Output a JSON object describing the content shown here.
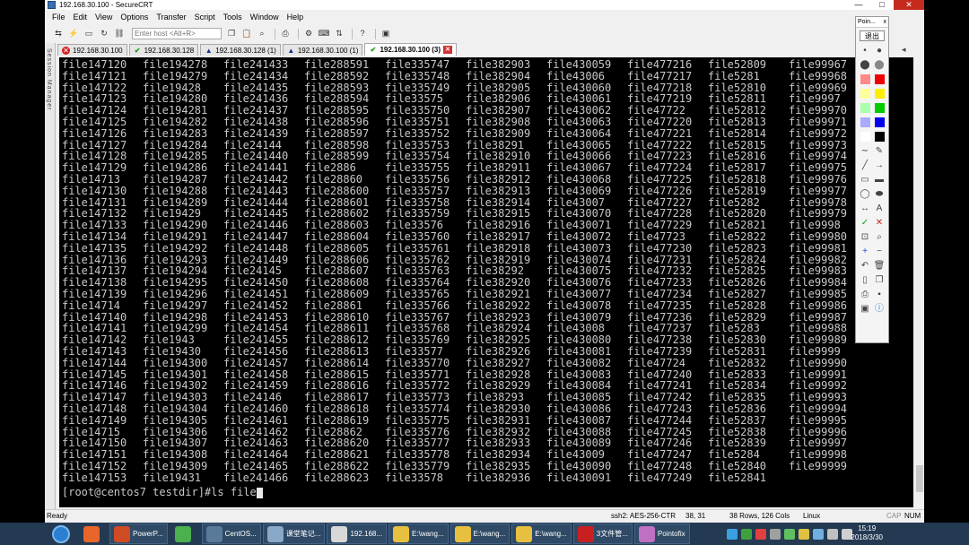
{
  "window": {
    "title": "192.168.30.100 - SecureCRT",
    "min": "—",
    "max": "□",
    "close": "✕"
  },
  "menu": [
    "File",
    "Edit",
    "View",
    "Options",
    "Transfer",
    "Script",
    "Tools",
    "Window",
    "Help"
  ],
  "toolbar": {
    "host_placeholder": "Enter host <Alt+R>"
  },
  "tabs": [
    {
      "label": "192.168.30.100",
      "status": "disconnected",
      "icon": "x-circle-icon"
    },
    {
      "label": "192.168.30.128",
      "status": "connected",
      "icon": "check-icon"
    },
    {
      "label": "192.168.30.128 (1)",
      "status": "warning",
      "icon": "warning-icon"
    },
    {
      "label": "192.168.30.100 (1)",
      "status": "warning",
      "icon": "warning-icon"
    },
    {
      "label": "192.168.30.100 (3)",
      "status": "connected",
      "icon": "check-icon",
      "active": true
    }
  ],
  "tab_nav": "◂ ▸",
  "session_manager_label": "Session Manager",
  "terminal": {
    "columns": [
      [
        "file147120",
        "file147121",
        "file147122",
        "file147123",
        "file147124",
        "file147125",
        "file147126",
        "file147127",
        "file147128",
        "file147129",
        "file14713",
        "file147130",
        "file147131",
        "file147132",
        "file147133",
        "file147134",
        "file147135",
        "file147136",
        "file147137",
        "file147138",
        "file147139",
        "file14714",
        "file147140",
        "file147141",
        "file147142",
        "file147143",
        "file147144",
        "file147145",
        "file147146",
        "file147147",
        "file147148",
        "file147149",
        "file14715",
        "file147150",
        "file147151",
        "file147152",
        "file147153"
      ],
      [
        "file194278",
        "file194279",
        "file19428",
        "file194280",
        "file194281",
        "file194282",
        "file194283",
        "file194284",
        "file194285",
        "file194286",
        "file194287",
        "file194288",
        "file194289",
        "file19429",
        "file194290",
        "file194291",
        "file194292",
        "file194293",
        "file194294",
        "file194295",
        "file194296",
        "file194297",
        "file194298",
        "file194299",
        "file1943",
        "file19430",
        "file194300",
        "file194301",
        "file194302",
        "file194303",
        "file194304",
        "file194305",
        "file194306",
        "file194307",
        "file194308",
        "file194309",
        "file19431"
      ],
      [
        "file241433",
        "file241434",
        "file241435",
        "file241436",
        "file241437",
        "file241438",
        "file241439",
        "file24144",
        "file241440",
        "file241441",
        "file241442",
        "file241443",
        "file241444",
        "file241445",
        "file241446",
        "file241447",
        "file241448",
        "file241449",
        "file24145",
        "file241450",
        "file241451",
        "file241452",
        "file241453",
        "file241454",
        "file241455",
        "file241456",
        "file241457",
        "file241458",
        "file241459",
        "file24146",
        "file241460",
        "file241461",
        "file241462",
        "file241463",
        "file241464",
        "file241465",
        "file241466"
      ],
      [
        "file288591",
        "file288592",
        "file288593",
        "file288594",
        "file288595",
        "file288596",
        "file288597",
        "file288598",
        "file288599",
        "file2886",
        "file28860",
        "file288600",
        "file288601",
        "file288602",
        "file288603",
        "file288604",
        "file288605",
        "file288606",
        "file288607",
        "file288608",
        "file288609",
        "file28861",
        "file288610",
        "file288611",
        "file288612",
        "file288613",
        "file288614",
        "file288615",
        "file288616",
        "file288617",
        "file288618",
        "file288619",
        "file28862",
        "file288620",
        "file288621",
        "file288622",
        "file288623"
      ],
      [
        "file335747",
        "file335748",
        "file335749",
        "file33575",
        "file335750",
        "file335751",
        "file335752",
        "file335753",
        "file335754",
        "file335755",
        "file335756",
        "file335757",
        "file335758",
        "file335759",
        "file33576",
        "file335760",
        "file335761",
        "file335762",
        "file335763",
        "file335764",
        "file335765",
        "file335766",
        "file335767",
        "file335768",
        "file335769",
        "file33577",
        "file335770",
        "file335771",
        "file335772",
        "file335773",
        "file335774",
        "file335775",
        "file335776",
        "file335777",
        "file335778",
        "file335779",
        "file33578"
      ],
      [
        "file382903",
        "file382904",
        "file382905",
        "file382906",
        "file382907",
        "file382908",
        "file382909",
        "file38291",
        "file382910",
        "file382911",
        "file382912",
        "file382913",
        "file382914",
        "file382915",
        "file382916",
        "file382917",
        "file382918",
        "file382919",
        "file38292",
        "file382920",
        "file382921",
        "file382922",
        "file382923",
        "file382924",
        "file382925",
        "file382926",
        "file382927",
        "file382928",
        "file382929",
        "file38293",
        "file382930",
        "file382931",
        "file382932",
        "file382933",
        "file382934",
        "file382935",
        "file382936"
      ],
      [
        "file430059",
        "file43006",
        "file430060",
        "file430061",
        "file430062",
        "file430063",
        "file430064",
        "file430065",
        "file430066",
        "file430067",
        "file430068",
        "file430069",
        "file43007",
        "file430070",
        "file430071",
        "file430072",
        "file430073",
        "file430074",
        "file430075",
        "file430076",
        "file430077",
        "file430078",
        "file430079",
        "file43008",
        "file430080",
        "file430081",
        "file430082",
        "file430083",
        "file430084",
        "file430085",
        "file430086",
        "file430087",
        "file430088",
        "file430089",
        "file43009",
        "file430090",
        "file430091"
      ],
      [
        "file477216",
        "file477217",
        "file477218",
        "file477219",
        "file47722",
        "file477220",
        "file477221",
        "file477222",
        "file477223",
        "file477224",
        "file477225",
        "file477226",
        "file477227",
        "file477228",
        "file477229",
        "file47723",
        "file477230",
        "file477231",
        "file477232",
        "file477233",
        "file477234",
        "file477235",
        "file477236",
        "file477237",
        "file477238",
        "file477239",
        "file47724",
        "file477240",
        "file477241",
        "file477242",
        "file477243",
        "file477244",
        "file477245",
        "file477246",
        "file477247",
        "file477248",
        "file477249"
      ],
      [
        "file52809",
        "file5281",
        "file52810",
        "file52811",
        "file52812",
        "file52813",
        "file52814",
        "file52815",
        "file52816",
        "file52817",
        "file52818",
        "file52819",
        "file5282",
        "file52820",
        "file52821",
        "file52822",
        "file52823",
        "file52824",
        "file52825",
        "file52826",
        "file52827",
        "file52828",
        "file52829",
        "file5283",
        "file52830",
        "file52831",
        "file52832",
        "file52833",
        "file52834",
        "file52835",
        "file52836",
        "file52837",
        "file52838",
        "file52839",
        "file5284",
        "file52840",
        "file52841"
      ],
      [
        "file99967",
        "file99968",
        "file99969",
        "file9997",
        "file99970",
        "file99971",
        "file99972",
        "file99973",
        "file99974",
        "file99975",
        "file99976",
        "file99977",
        "file99978",
        "file99979",
        "file9998",
        "file99980",
        "file99981",
        "file99982",
        "file99983",
        "file99984",
        "file99985",
        "file99986",
        "file99987",
        "file99988",
        "file99989",
        "file9999",
        "file99990",
        "file99991",
        "file99992",
        "file99993",
        "file99994",
        "file99995",
        "file99996",
        "file99997",
        "file99998",
        "file99999",
        ""
      ]
    ],
    "prompt": "[root@centos7 testdir]#ls file"
  },
  "status": {
    "ready": "Ready",
    "cipher": "ssh2: AES-256-CTR",
    "position": "38,  31",
    "size": "38 Rows, 126 Cols",
    "os": "Linux",
    "caps": "CAP",
    "num": "NUM"
  },
  "pointofix": {
    "title": "Poin...",
    "close": "x",
    "exit": "退出",
    "swatches": [
      "#ff8888",
      "#ee0000",
      "#ffff99",
      "#ffee00",
      "#aaffaa",
      "#00cc00",
      "#aaaaff",
      "#0000ee",
      "#ffffff",
      "#000000"
    ]
  },
  "taskbar": {
    "items": [
      {
        "label": "",
        "icon": "firefox-icon",
        "color": "#e8662a"
      },
      {
        "label": "PowerP...",
        "icon": "powerpoint-icon",
        "color": "#d04a24"
      },
      {
        "label": "",
        "icon": "chrome-icon",
        "color": "#4caf50"
      },
      {
        "label": "CentOS...",
        "icon": "vm-icon",
        "color": "#5a7a9a"
      },
      {
        "label": "课堂笔记...",
        "icon": "notepad-icon",
        "color": "#8aa8c8"
      },
      {
        "label": "192.168...",
        "icon": "terminal-icon",
        "color": "#d8d8d8"
      },
      {
        "label": "E:\\wang...",
        "icon": "folder-icon",
        "color": "#e8c040"
      },
      {
        "label": "E:\\wang...",
        "icon": "folder-icon",
        "color": "#e8c040"
      },
      {
        "label": "E:\\wang...",
        "icon": "folder-icon",
        "color": "#e8c040"
      },
      {
        "label": "3文件管...",
        "icon": "pdf-icon",
        "color": "#c82020"
      },
      {
        "label": "Pointofix",
        "icon": "pointofix-icon",
        "color": "#c070c0"
      }
    ],
    "clock_time": "15:19",
    "clock_date": "2018/3/30"
  }
}
